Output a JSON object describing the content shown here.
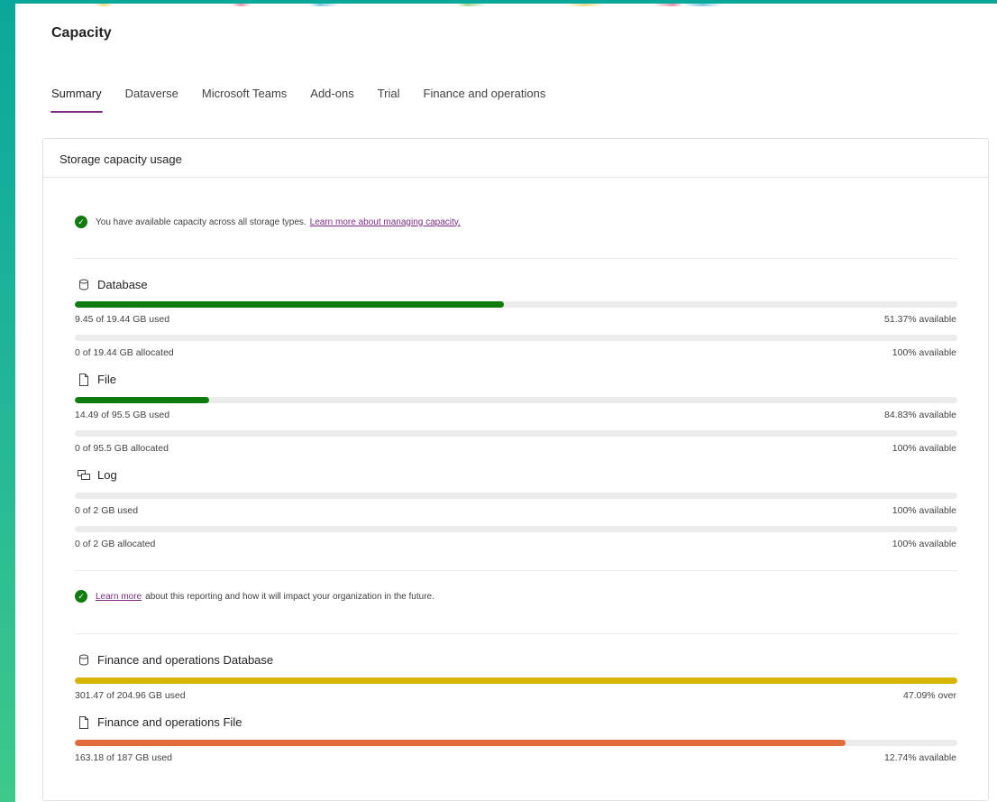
{
  "page": {
    "title": "Capacity"
  },
  "tabs": [
    {
      "label": "Summary",
      "active": true
    },
    {
      "label": "Dataverse",
      "active": false
    },
    {
      "label": "Microsoft Teams",
      "active": false
    },
    {
      "label": "Add-ons",
      "active": false
    },
    {
      "label": "Trial",
      "active": false
    },
    {
      "label": "Finance and operations",
      "active": false
    }
  ],
  "card": {
    "title": "Storage capacity usage",
    "notice1": {
      "text": "You have available capacity across all storage types.",
      "link": "Learn more about managing capacity.",
      "icon": "check-circle-icon"
    },
    "notice2": {
      "link": "Learn more",
      "text": "about this reporting and how it will impact your organization in the future.",
      "icon": "check-circle-icon"
    }
  },
  "sections": {
    "database": {
      "title": "Database",
      "icon": "database-icon",
      "used_label": "9.45 of 19.44 GB used",
      "used_right": "51.37% available",
      "used_fraction": 0.486,
      "alloc_label": "0 of 19.44 GB allocated",
      "alloc_right": "100% available",
      "alloc_fraction": 0
    },
    "file": {
      "title": "File",
      "icon": "file-icon",
      "used_label": "14.49 of 95.5 GB used",
      "used_right": "84.83% available",
      "used_fraction": 0.152,
      "alloc_label": "0 of 95.5 GB allocated",
      "alloc_right": "100% available",
      "alloc_fraction": 0
    },
    "log": {
      "title": "Log",
      "icon": "log-icon",
      "used_label": "0 of 2 GB used",
      "used_right": "100% available",
      "used_fraction": 0,
      "alloc_label": "0 of 2 GB allocated",
      "alloc_right": "100% available",
      "alloc_fraction": 0
    },
    "fo_database": {
      "title": "Finance and operations Database",
      "icon": "database-icon",
      "used_label": "301.47 of 204.96 GB used",
      "used_right": "47.09% over",
      "used_fraction": 1.0
    },
    "fo_file": {
      "title": "Finance and operations File",
      "icon": "file-icon",
      "used_label": "163.18 of 187 GB used",
      "used_right": "12.74% available",
      "used_fraction": 0.873
    }
  },
  "colors": {
    "accent": "#7b2c83",
    "ok_green": "#107c10",
    "warning_yellow": "#d6b400",
    "over_orange": "#e06b3c",
    "track": "#ebebeb"
  }
}
